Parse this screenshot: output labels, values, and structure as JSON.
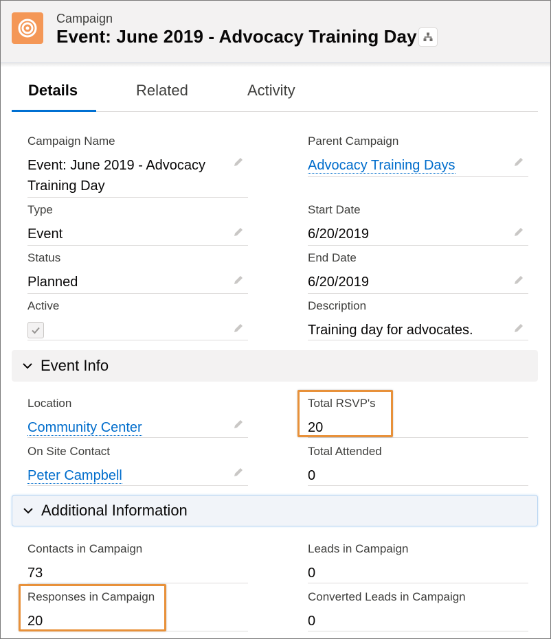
{
  "header": {
    "object_label": "Campaign",
    "title": "Event: June 2019 - Advocacy Training Day",
    "icon": "campaign-target-icon",
    "icon_color": "#f49756"
  },
  "tabs": [
    {
      "label": "Details",
      "active": true
    },
    {
      "label": "Related",
      "active": false
    },
    {
      "label": "Activity",
      "active": false
    }
  ],
  "fields": {
    "campaign_name": {
      "label": "Campaign Name",
      "value_line1": "Event: June 2019 - Advocacy",
      "value_line2": "Training Day"
    },
    "parent_campaign": {
      "label": "Parent Campaign",
      "value": "Advocacy Training Days"
    },
    "type": {
      "label": "Type",
      "value": "Event"
    },
    "start_date": {
      "label": "Start Date",
      "value": "6/20/2019"
    },
    "status": {
      "label": "Status",
      "value": "Planned"
    },
    "end_date": {
      "label": "End Date",
      "value": "6/20/2019"
    },
    "active": {
      "label": "Active",
      "checked": true
    },
    "description": {
      "label": "Description",
      "value": "Training day for advocates."
    }
  },
  "event_info": {
    "title": "Event Info",
    "location": {
      "label": "Location",
      "value": "Community Center"
    },
    "total_rsvps": {
      "label": "Total RSVP's",
      "value": "20"
    },
    "on_site_contact": {
      "label": "On Site Contact",
      "value": "Peter Campbell"
    },
    "total_attended": {
      "label": "Total Attended",
      "value": "0"
    }
  },
  "additional_info": {
    "title": "Additional Information",
    "contacts": {
      "label": "Contacts in Campaign",
      "value": "73"
    },
    "leads": {
      "label": "Leads in Campaign",
      "value": "0"
    },
    "responses": {
      "label": "Responses in Campaign",
      "value": "20"
    },
    "converted_leads": {
      "label": "Converted Leads in Campaign",
      "value": "0"
    }
  },
  "colors": {
    "accent": "#0070d2",
    "link": "#006dcc",
    "highlight": "#e8913a"
  }
}
